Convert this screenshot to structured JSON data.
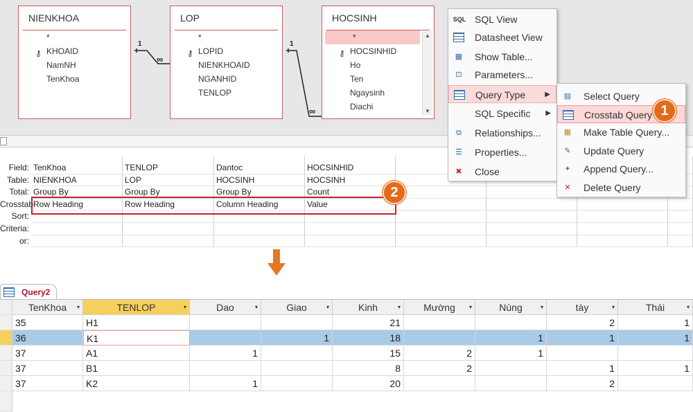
{
  "tables": [
    {
      "title": "NIENKHOA",
      "fields": [
        "*",
        "KHOAID",
        "NamNH",
        "TenKhoa"
      ],
      "key_index": 1
    },
    {
      "title": "LOP",
      "fields": [
        "*",
        "LOPID",
        "NIENKHOAID",
        "NGANHID",
        "TENLOP"
      ],
      "key_index": 1
    },
    {
      "title": "HOCSINH",
      "fields": [
        "*",
        "HOCSINHID",
        "Ho",
        "Ten",
        "Ngaysinh",
        "Diachi"
      ],
      "key_index": 1
    }
  ],
  "relationships": {
    "one_label": "1",
    "many_label": "∞"
  },
  "context_menu": [
    {
      "label": "SQL View",
      "icon": "sql-icon",
      "icon_text": "SQL"
    },
    {
      "label": "Datasheet View",
      "icon": "datasheet-icon"
    },
    {
      "label": "Show Table...",
      "icon": "show-table-icon"
    },
    {
      "label": "Parameters...",
      "icon": "parameters-icon"
    },
    {
      "label": "Query Type",
      "icon": "query-type-icon",
      "submenu": true
    },
    {
      "label": "SQL Specific",
      "icon": "",
      "submenu": true
    },
    {
      "label": "Relationships...",
      "icon": "relationships-icon"
    },
    {
      "label": "Properties...",
      "icon": "properties-icon"
    },
    {
      "label": "Close",
      "icon": "close-icon"
    }
  ],
  "sub_menu": [
    {
      "label": "Select Query",
      "icon": "select-query-icon"
    },
    {
      "label": "Crosstab Query",
      "icon": "crosstab-query-icon"
    },
    {
      "label": "Make Table Query...",
      "icon": "make-table-query-icon"
    },
    {
      "label": "Update Query",
      "icon": "update-query-icon"
    },
    {
      "label": "Append Query...",
      "icon": "append-query-icon"
    },
    {
      "label": "Delete Query",
      "icon": "delete-query-icon"
    }
  ],
  "badges": {
    "one": "1",
    "two": "2"
  },
  "design_grid": {
    "row_labels": [
      "Field:",
      "Table:",
      "Total:",
      "Crosstab:",
      "Sort:",
      "Criteria:",
      "or:"
    ],
    "columns": [
      {
        "field": "TenKhoa",
        "table": "NIENKHOA",
        "total": "Group By",
        "crosstab": "Row Heading"
      },
      {
        "field": "TENLOP",
        "table": "LOP",
        "total": "Group By",
        "crosstab": "Row Heading"
      },
      {
        "field": "Dantoc",
        "table": "HOCSINH",
        "total": "Group By",
        "crosstab": "Column Heading"
      },
      {
        "field": "HOCSINHID",
        "table": "HOCSINH",
        "total": "Count",
        "crosstab": "Value"
      },
      {
        "field": "",
        "table": "",
        "total": "",
        "crosstab": ""
      },
      {
        "field": "",
        "table": "",
        "total": "",
        "crosstab": ""
      },
      {
        "field": "",
        "table": "",
        "total": "",
        "crosstab": ""
      },
      {
        "field": "",
        "table": "",
        "total": "",
        "crosstab": ""
      }
    ]
  },
  "result_tab": {
    "label": "Query2"
  },
  "datasheet": {
    "headers": [
      "TenKhoa",
      "TENLOP",
      "Dao",
      "Giao",
      "Kinh",
      "Mường",
      "Nùng",
      "tày",
      "Thái"
    ],
    "rows": [
      [
        "35",
        "H1",
        "",
        "",
        "21",
        "",
        "",
        "2",
        "1"
      ],
      [
        "36",
        "K1",
        "",
        "1",
        "18",
        "",
        "1",
        "1",
        "1"
      ],
      [
        "37",
        "A1",
        "1",
        "",
        "15",
        "2",
        "1",
        "",
        ""
      ],
      [
        "37",
        "B1",
        "",
        "",
        "8",
        "2",
        "",
        "1",
        "1"
      ],
      [
        "37",
        "K2",
        "1",
        "",
        "20",
        "",
        "",
        "2",
        ""
      ]
    ],
    "selected_row": 1,
    "active_column": 1
  },
  "colors": {
    "accent": "#e26a1a",
    "highlight": "#c3232b",
    "selection": "#a8cbe8",
    "active_header": "#f6d05e"
  }
}
